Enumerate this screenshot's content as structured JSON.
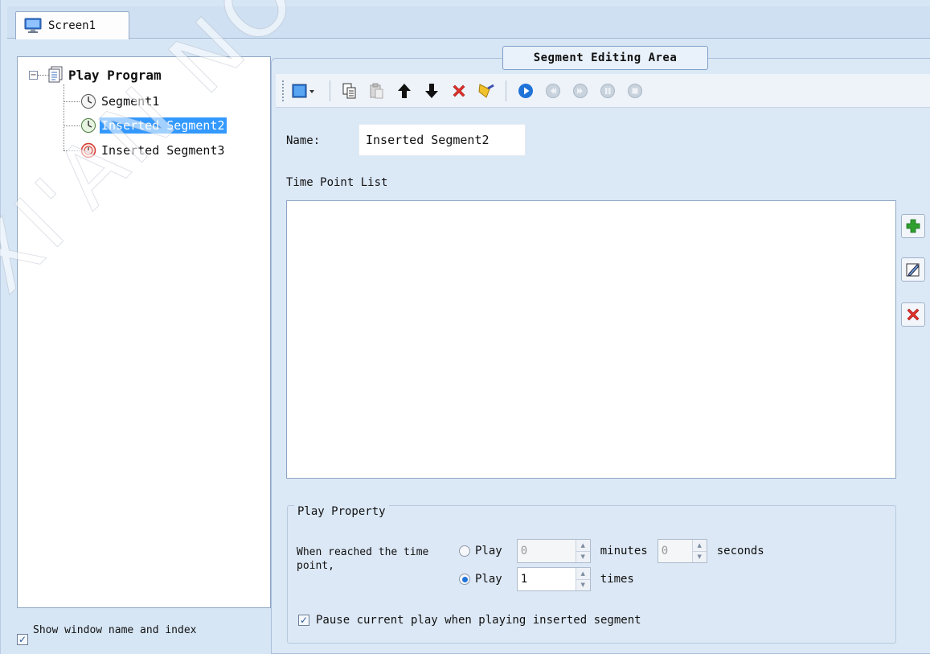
{
  "tab": {
    "label": "Screen1"
  },
  "tree": {
    "root": "Play Program",
    "items": [
      {
        "label": "Segment1",
        "icon": "clock-icon"
      },
      {
        "label": "Inserted Segment2",
        "icon": "clock-icon",
        "selected": true
      },
      {
        "label": "Inserted Segment3",
        "icon": "red-clock-icon"
      }
    ],
    "expander": "−"
  },
  "show_window": {
    "label": "Show window name and index",
    "checked": true
  },
  "segment_area": {
    "title": "Segment Editing Area",
    "name_label": "Name:",
    "name_value": "Inserted Segment2",
    "time_point_label": "Time Point List"
  },
  "play_property": {
    "legend": "Play Property",
    "when_text": "When reached the time point,",
    "option1": {
      "label": "Play",
      "minutes_value": "0",
      "minutes_label": "minutes",
      "seconds_value": "0",
      "seconds_label": "seconds",
      "selected": false
    },
    "option2": {
      "label": "Play",
      "times_value": "1",
      "times_label": "times",
      "selected": true
    },
    "pause_label": "Pause current play when playing inserted segment",
    "pause_checked": true
  },
  "watermark": "XI'AN NOVASTAR",
  "colors": {
    "selection": "#3399ff",
    "panel": "#dbe8f6",
    "accent_blue": "#1f73d8",
    "delete_red": "#e0302a",
    "add_green": "#2fa02f"
  }
}
